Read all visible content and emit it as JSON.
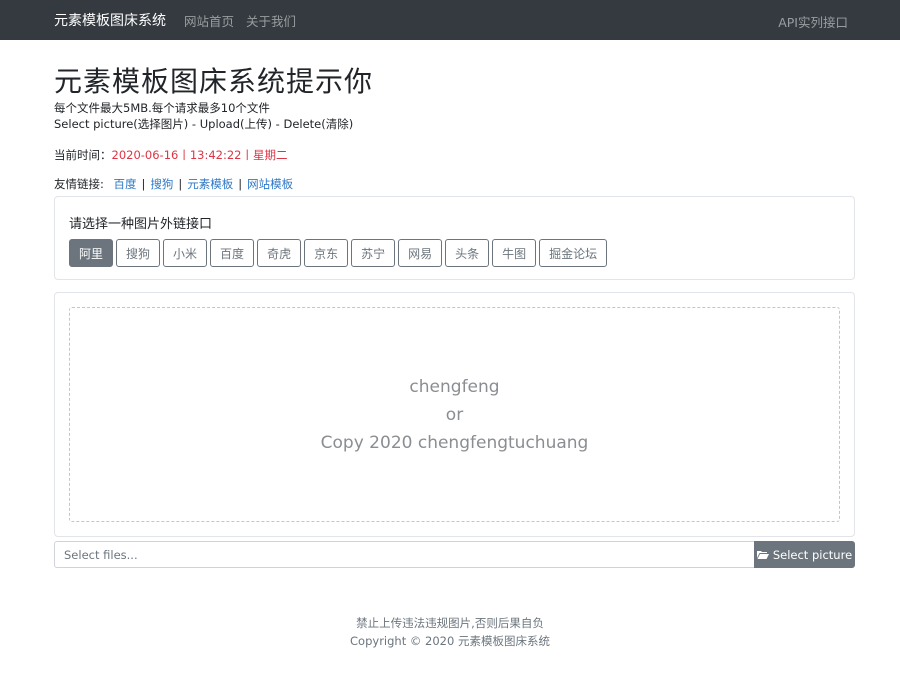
{
  "navbar": {
    "brand": "元素模板图床系统",
    "links": [
      "网站首页",
      "关于我们"
    ],
    "right_link": "API实列接口"
  },
  "header": {
    "title": "元素模板图床系统提示你",
    "line1": "每个文件最大5MB.每个请求最多10个文件",
    "line2": "Select picture(选择图片) - Upload(上传) - Delete(清除)"
  },
  "time": {
    "label": "当前时间：",
    "value": "2020-06-16丨13:42:22丨星期二"
  },
  "friend_links": {
    "label": "友情链接:",
    "items": [
      "百度",
      "搜狗",
      "元素模板",
      "网站模板"
    ],
    "separator": "|"
  },
  "interface_select": {
    "label": "请选择一种图片外链接口",
    "options": [
      "阿里",
      "搜狗",
      "小米",
      "百度",
      "奇虎",
      "京东",
      "苏宁",
      "网易",
      "头条",
      "牛图",
      "掘金论坛"
    ],
    "active_index": 0
  },
  "dropzone": {
    "line1": "chengfeng",
    "line2": "or",
    "line3": "Copy 2020 chengfengtuchuang"
  },
  "file_select": {
    "placeholder": "Select files...",
    "button_label": "Select picture",
    "button_icon": "folder-open-icon"
  },
  "footer": {
    "line1": "禁止上传违法违规图片,否则后果自负",
    "line2": "Copyright © 2020 元素模板图床系统"
  },
  "colors": {
    "navbar_bg": "#343a40",
    "time_red": "#dc3545",
    "link_blue": "#2e78c7",
    "button_gray": "#6c757d"
  }
}
